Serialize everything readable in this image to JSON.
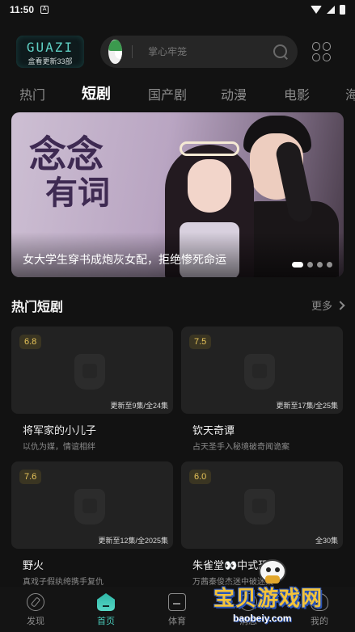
{
  "status_bar": {
    "time": "11:50",
    "app_icon": "A"
  },
  "header": {
    "logo_text": "GUAZI",
    "logo_sub": "盒看更新33部",
    "search_placeholder": "掌心牢笼"
  },
  "tabs": [
    {
      "label": "热门"
    },
    {
      "label": "短剧"
    },
    {
      "label": "国产剧"
    },
    {
      "label": "动漫"
    },
    {
      "label": "电影"
    },
    {
      "label": "海"
    }
  ],
  "banner": {
    "title_art_line1": "念念",
    "title_art_line2": "有词",
    "caption": "女大学生穿书成炮灰女配，拒绝惨死命运",
    "active_dot": 1,
    "dot_count": 4
  },
  "section": {
    "title": "热门短剧",
    "more_label": "更多"
  },
  "cards": [
    {
      "score": "6.8",
      "progress": "更新至9集/全24集",
      "name": "将军家的小儿子",
      "desc": "以仇为媒，情谊相绊"
    },
    {
      "score": "7.5",
      "progress": "更新至17集/全25集",
      "name": "钦天奇谭",
      "desc": "占天圣手入秘境破奇闻诡案"
    },
    {
      "score": "7.6",
      "progress": "更新至12集/全2025集",
      "name": "野火",
      "desc": "真戏子假纨绔携手复仇"
    },
    {
      "score": "6.0",
      "progress": "全30集",
      "name": "朱雀堂👀中式恐怖",
      "desc": "万茜秦俊杰迷中破迷案"
    }
  ],
  "bottom_nav": [
    {
      "label": "发现",
      "icon": "compass-icon"
    },
    {
      "label": "首页",
      "icon": "home-icon"
    },
    {
      "label": "体育",
      "icon": "sports-icon"
    },
    {
      "label": "消息",
      "icon": "chat-icon"
    },
    {
      "label": "我的",
      "icon": "user-icon"
    }
  ],
  "watermark": {
    "text": "宝贝游戏网",
    "url": "baobeiy.com"
  },
  "colors": {
    "accent": "#49c7b8",
    "score_text": "#e8c55a",
    "background": "#121212"
  }
}
